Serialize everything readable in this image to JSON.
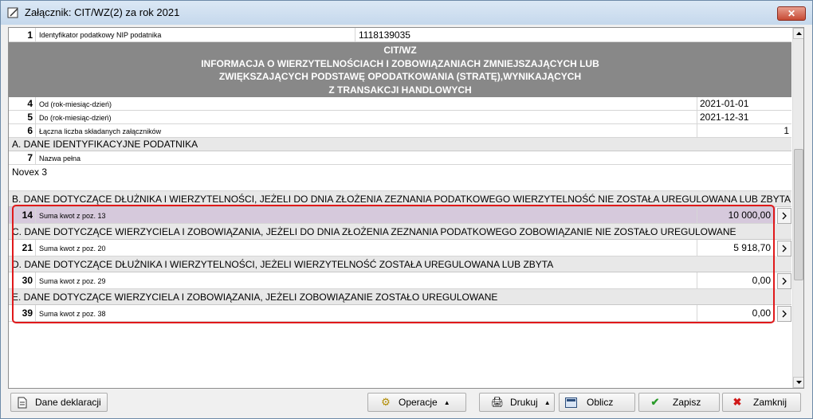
{
  "window": {
    "title": "Załącznik: CIT/WZ(2) za rok 2021",
    "close_label": "✕"
  },
  "rows": {
    "r1": {
      "num": "1",
      "label": "Identyfikator podatkowy NIP podatnika",
      "value": "1118139035"
    },
    "header": {
      "line1": "CIT/WZ",
      "line2": "INFORMACJA O WIERZYTELNOŚCIACH I ZOBOWIĄZANIACH ZMNIEJSZAJĄCYCH LUB",
      "line3": "ZWIĘKSZAJĄCYCH PODSTAWĘ OPODATKOWANIA (STRATĘ),WYNIKAJĄCYCH",
      "line4": "Z TRANSAKCJI HANDLOWYCH"
    },
    "r4": {
      "num": "4",
      "label": "Od (rok-miesiąc-dzień)",
      "value": "2021-01-01"
    },
    "r5": {
      "num": "5",
      "label": "Do (rok-miesiąc-dzień)",
      "value": "2021-12-31"
    },
    "r6": {
      "num": "6",
      "label": "Łączna liczba składanych załączników",
      "value": "1"
    }
  },
  "section_a": {
    "title": "A. DANE IDENTYFIKACYJNE PODATNIKA",
    "num": "7",
    "label": "Nazwa pełna",
    "value": "Novex 3"
  },
  "section_b": {
    "title": "B. DANE DOTYCZĄCE DŁUŻNIKA I WIERZYTELNOŚCI, JEŻELI DO DNIA ZŁOŻENIA ZEZNANIA PODATKOWEGO WIERZYTELNOŚĆ NIE ZOSTAŁA UREGULOWANA LUB ZBYTA",
    "num": "14",
    "label": "Suma kwot z poz. 13",
    "value": "10 000,00"
  },
  "section_c": {
    "title": "C. DANE DOTYCZĄCE WIERZYCIELA I ZOBOWIĄZANIA, JEŻELI DO DNIA ZŁOŻENIA ZEZNANIA PODATKOWEGO ZOBOWIĄZANIE NIE ZOSTAŁO UREGULOWANE",
    "num": "21",
    "label": "Suma kwot z poz. 20",
    "value": "5 918,70"
  },
  "section_d": {
    "title": "D. DANE DOTYCZĄCE DŁUŻNIKA I WIERZYTELNOŚCI, JEŻELI WIERZYTELNOŚĆ ZOSTAŁA UREGULOWANA LUB ZBYTA",
    "num": "30",
    "label": "Suma kwot z poz. 29",
    "value": "0,00"
  },
  "section_e": {
    "title": "E. DANE DOTYCZĄCE WIERZYCIELA I ZOBOWIĄZANIA, JEŻELI ZOBOWIĄZANIE ZOSTAŁO UREGULOWANE",
    "num": "39",
    "label": "Suma kwot z poz. 38",
    "value": "0,00"
  },
  "toolbar": {
    "dane_label": "Dane deklaracji",
    "operacje_label": "Operacje",
    "drukuj_label": "Drukuj",
    "oblicz_label": "Oblicz",
    "zapisz_label": "Zapisz",
    "zamknij_label": "Zamknij"
  },
  "colors": {
    "highlight_row": "#d6c9dc",
    "red_outline": "#e0191b",
    "header_bg": "#888888"
  }
}
